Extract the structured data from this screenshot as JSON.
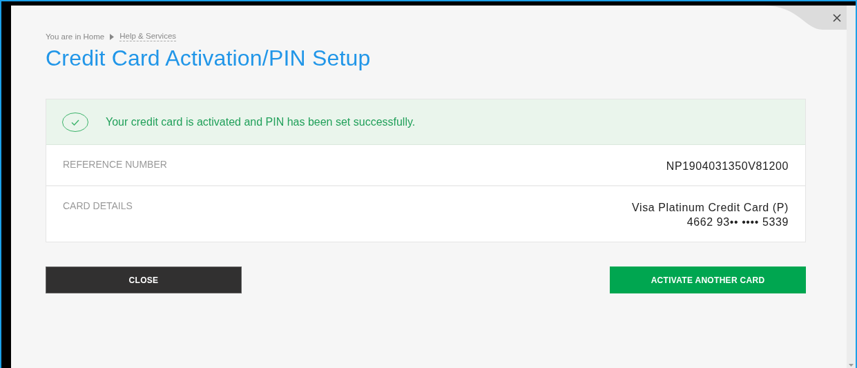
{
  "breadcrumb": {
    "current": "You are in Home",
    "link": "Help & Services"
  },
  "title": "Credit Card Activation/PIN Setup",
  "status": {
    "kind": "success",
    "message": "Your credit card is activated and PIN has been set successfully."
  },
  "details": [
    {
      "label": "REFERENCE NUMBER",
      "values": [
        "NP1904031350V81200"
      ]
    },
    {
      "label": "CARD DETAILS",
      "values": [
        "Visa Platinum Credit Card (P)",
        "4662 93•• •••• 5339"
      ]
    }
  ],
  "buttons": [
    {
      "label": "CLOSE",
      "kind": "secondary"
    },
    {
      "label": "ACTIVATE ANOTHER CARD",
      "kind": "primary"
    }
  ]
}
